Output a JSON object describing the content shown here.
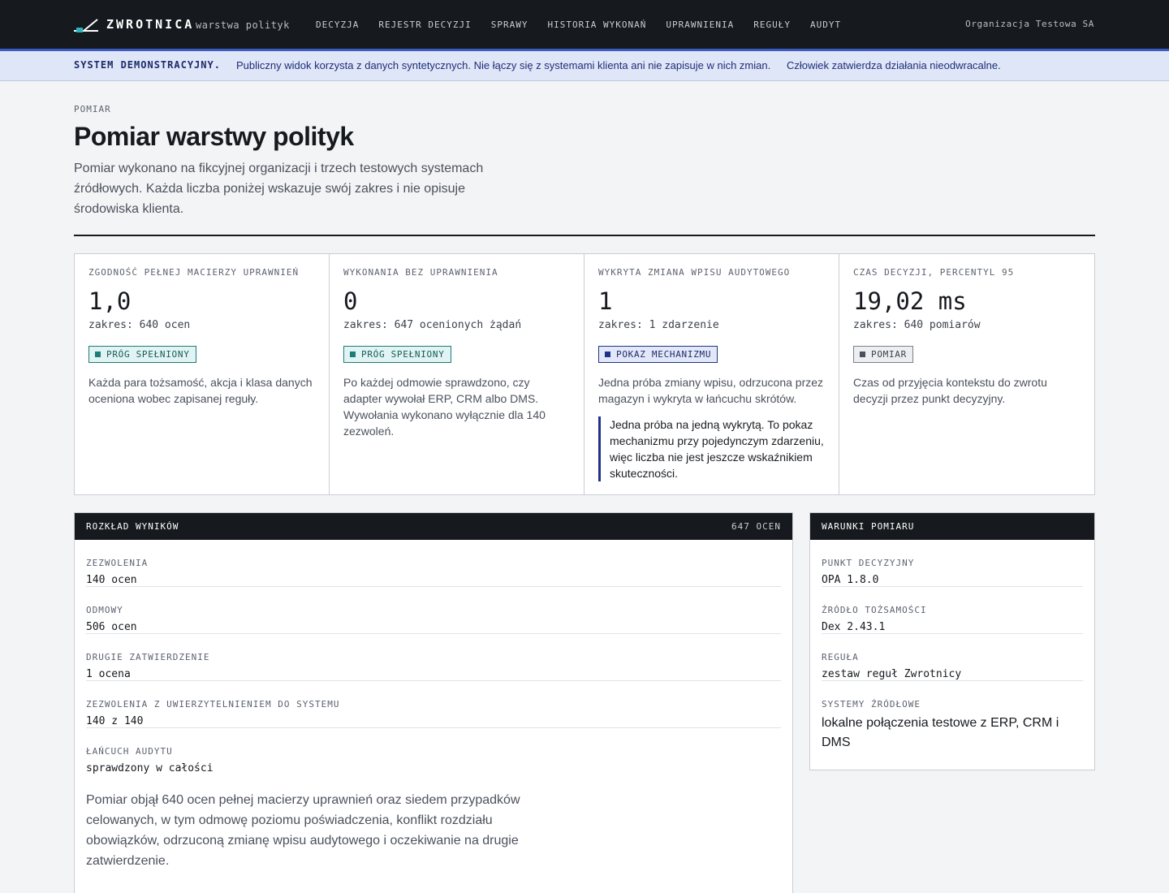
{
  "header": {
    "brand": "ZWROTNICA",
    "brand_sub": "warstwa polityk",
    "nav": [
      "DECYZJA",
      "REJESTR DECYZJI",
      "SPRAWY",
      "HISTORIA WYKONAŃ",
      "UPRAWNIENIA",
      "REGUŁY",
      "AUDYT"
    ],
    "organization": "Organizacja Testowa SA"
  },
  "banner": {
    "label": "SYSTEM DEMONSTRACYJNY.",
    "text": "Publiczny widok korzysta z danych syntetycznych. Nie łączy się z systemami klienta ani nie zapisuje w nich zmian.",
    "text2": "Człowiek zatwierdza działania nieodwracalne."
  },
  "page": {
    "eyebrow": "POMIAR",
    "title": "Pomiar warstwy polityk",
    "lead": "Pomiar wykonano na fikcyjnej organizacji i trzech testowych systemach źródłowych. Każda liczba poniżej wskazuje swój zakres i nie opisuje środowiska klienta."
  },
  "metrics": [
    {
      "label": "ZGODNOŚĆ PEŁNEJ MACIERZY UPRAWNIEŃ",
      "value": "1,0",
      "scope": "zakres: 640 ocen",
      "badge": "PRÓG SPEŁNIONY",
      "badge_kind": "pass",
      "description": "Każda para tożsamość, akcja i klasa danych oceniona wobec zapisanej reguły."
    },
    {
      "label": "WYKONANIA BEZ UPRAWNIENIA",
      "value": "0",
      "scope": "zakres: 647 ocenionych żądań",
      "badge": "PRÓG SPEŁNIONY",
      "badge_kind": "pass",
      "description": "Po każdej odmowie sprawdzono, czy adapter wywołał ERP, CRM albo DMS. Wywołania wykonano wyłącznie dla 140 zezwoleń."
    },
    {
      "label": "WYKRYTA ZMIANA WPISU AUDYTOWEGO",
      "value": "1",
      "scope": "zakres: 1 zdarzenie",
      "badge": "POKAZ MECHANIZMU",
      "badge_kind": "mech",
      "description": "Jedna próba zmiany wpisu, odrzucona przez magazyn i wykryta w łańcuchu skrótów.",
      "note": "Jedna próba na jedną wykrytą. To pokaz mechanizmu przy pojedynczym zdarzeniu, więc liczba nie jest jeszcze wskaźnikiem skuteczności."
    },
    {
      "label": "CZAS DECYZJI, PERCENTYL 95",
      "value": "19,02 ms",
      "scope": "zakres: 640 pomiarów",
      "badge": "POMIAR",
      "badge_kind": "meas",
      "description": "Czas od przyjęcia kontekstu do zwrotu decyzji przez punkt decyzyjny."
    }
  ],
  "distribution": {
    "title": "ROZKŁAD WYNIKÓW",
    "count": "647 OCEN",
    "rows": [
      {
        "label": "ZEZWOLENIA",
        "value": "140 ocen"
      },
      {
        "label": "ODMOWY",
        "value": "506 ocen"
      },
      {
        "label": "DRUGIE ZATWIERDZENIE",
        "value": "1 ocena"
      },
      {
        "label": "ZEZWOLENIA Z UWIERZYTELNIENIEM DO SYSTEMU",
        "value": "140 z 140"
      },
      {
        "label": "ŁAŃCUCH AUDYTU",
        "value": "sprawdzony w całości"
      }
    ],
    "summary": "Pomiar objął 640 ocen pełnej macierzy uprawnień oraz siedem przypadków celowanych, w tym odmowę poziomu poświadczenia, konflikt rozdziału obowiązków, odrzuconą zmianę wpisu audytowego i oczekiwanie na drugie zatwierdzenie."
  },
  "conditions": {
    "title": "WARUNKI POMIARU",
    "rows": [
      {
        "label": "PUNKT DECYZYJNY",
        "value": "OPA 1.8.0"
      },
      {
        "label": "ŹRÓDŁO TOŻSAMOŚCI",
        "value": "Dex 2.43.1"
      },
      {
        "label": "REGUŁA",
        "value": "zestaw reguł Zwrotnicy"
      },
      {
        "label": "SYSTEMY ŹRÓDŁOWE",
        "value": "lokalne połączenia testowe z ERP, CRM i DMS"
      }
    ]
  },
  "colors": {
    "topbar": "#16191e",
    "banner_bg": "#dfe6f7",
    "banner_accent": "#3c5cc4",
    "pass": "#1e7c7a",
    "mechanism": "#1e3488",
    "logo_accent": "#2bb3c0"
  },
  "icons": {
    "logo": "switch-track-logo-icon"
  }
}
